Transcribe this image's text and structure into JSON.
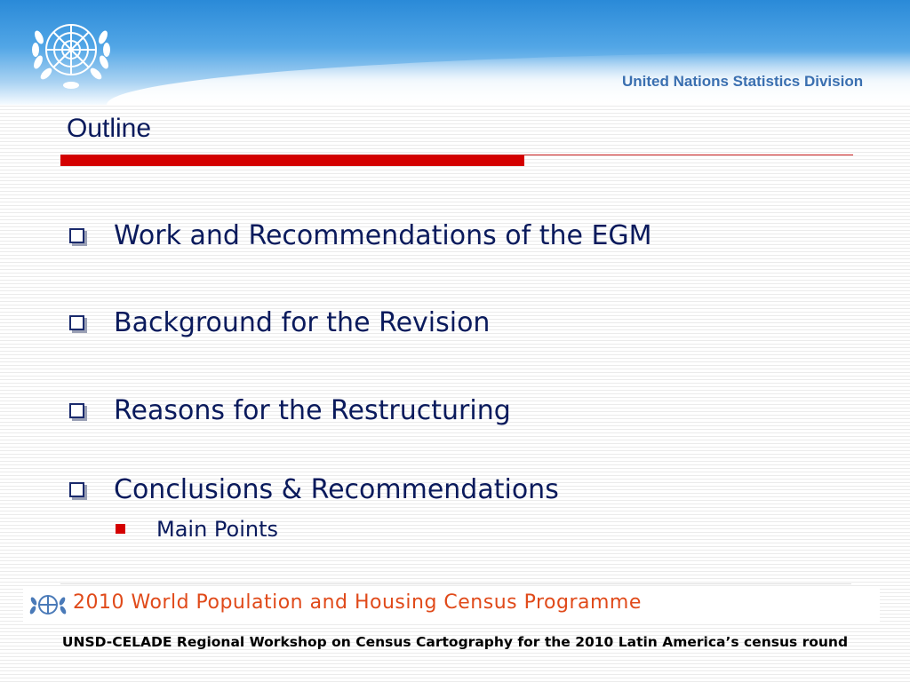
{
  "header": {
    "organization": "United Nations Statistics Division",
    "emblem_icon": "un-emblem-icon",
    "colors": {
      "header_blue": "#2a8ad8",
      "org_text": "#3a6fb0"
    }
  },
  "slide": {
    "title": "Outline",
    "accent_color": "#d40000",
    "bullets": [
      {
        "text": "Work and Recommendations of the EGM"
      },
      {
        "text": "Background for the Revision"
      },
      {
        "text": "Reasons for the Restructuring"
      },
      {
        "text": "Conclusions & Recommendations",
        "sub_items": [
          "Main Points"
        ]
      }
    ]
  },
  "footer": {
    "programme_banner": "2010 World Population and Housing Census Programme",
    "banner_logo_icon": "census-programme-logo-icon",
    "caption": "UNSD-CELADE Regional Workshop on Census Cartography for the 2010 Latin America’s census round"
  }
}
